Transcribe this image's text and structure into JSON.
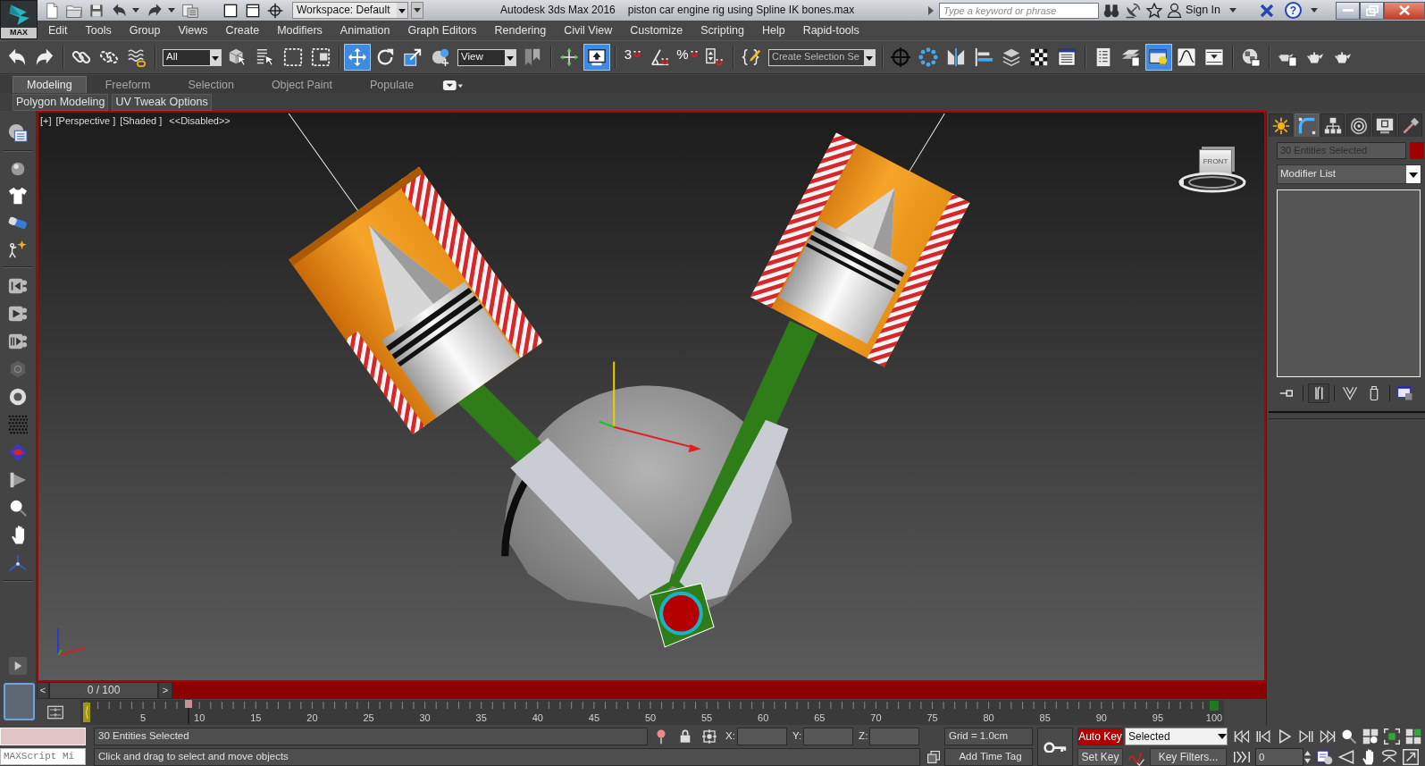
{
  "title_bar": {
    "app_button": "MAX",
    "workspace": "Workspace: Default",
    "app_name": "Autodesk 3ds Max 2016",
    "file_name": "piston car engine rig using Spline IK bones.max",
    "search": {
      "placeholder": "Type a keyword or phrase"
    },
    "sign_in": "Sign In",
    "help": "?"
  },
  "menu_bar": [
    "Edit",
    "Tools",
    "Group",
    "Views",
    "Create",
    "Modifiers",
    "Animation",
    "Graph Editors",
    "Rendering",
    "Civil View",
    "Customize",
    "Scripting",
    "Help",
    "Rapid-tools"
  ],
  "main_toolbar": {
    "selection_filter": "All",
    "transform_tools": [
      {
        "kind": "move",
        "selected": true
      },
      {
        "kind": "rotate",
        "selected": false
      },
      {
        "kind": "scale",
        "selected": false
      },
      {
        "kind": "place",
        "selected": false
      }
    ],
    "coordinate_system": "View",
    "keyboard_override_on": true,
    "snap_toggle": "3",
    "percent_snap": "%",
    "named_selection_set": "Create Selection Se",
    "ribbon_toggle_on": true
  },
  "ribbon": {
    "tabs": [
      {
        "label": "Modeling",
        "selected": true
      },
      {
        "label": "Freeform",
        "selected": false
      },
      {
        "label": "Selection",
        "selected": false
      },
      {
        "label": "Object Paint",
        "selected": false
      },
      {
        "label": "Populate",
        "selected": false
      }
    ],
    "panels": [
      "Polygon Modeling",
      "UV Tweak Options"
    ]
  },
  "viewport": {
    "labels": [
      "[+]",
      "[Perspective ]",
      "[Shaded ]",
      "<<Disabled>>"
    ],
    "viewcube_face": "FRONT"
  },
  "command_panel": {
    "tabs": [
      {
        "kind": "create",
        "selected": false
      },
      {
        "kind": "modify",
        "selected": true
      },
      {
        "kind": "hierarchy",
        "selected": false
      },
      {
        "kind": "motion",
        "selected": false
      },
      {
        "kind": "display",
        "selected": false
      },
      {
        "kind": "utilities",
        "selected": false
      }
    ],
    "object_name": "30 Entities Selected",
    "modifier_list": "Modifier List",
    "stack_tools": [
      {
        "kind": "pin",
        "on": false
      },
      {
        "kind": "end_result",
        "on": true
      },
      {
        "kind": "make_unique",
        "on": false
      },
      {
        "kind": "remove",
        "on": false
      },
      {
        "kind": "configure",
        "on": false
      }
    ]
  },
  "time_slider": {
    "previous": "<",
    "label": "0 / 100",
    "next": ">",
    "level": 0
  },
  "track_bar": {
    "frame_labels": [
      "5",
      "10",
      "15",
      "20",
      "25",
      "30",
      "35",
      "40",
      "45",
      "50",
      "55",
      "60",
      "65",
      "70",
      "75",
      "80",
      "85",
      "90",
      "95",
      "100"
    ]
  },
  "status_bar": {
    "listener": "MAXScript Mi",
    "selection": "30 Entities Selected",
    "prompt": "Click and drag to select and move objects",
    "coordinates": [
      "X:",
      "Y:",
      "Z:"
    ],
    "grid": "Grid = 1.0cm",
    "time_tag": "Add Time Tag"
  },
  "animation_controls": {
    "auto_key": {
      "label": "Auto Key",
      "on": true
    },
    "key_mode": "Selected",
    "set_key": "Set Key",
    "key_filters": "Key Filters...",
    "current_frame": "0"
  }
}
